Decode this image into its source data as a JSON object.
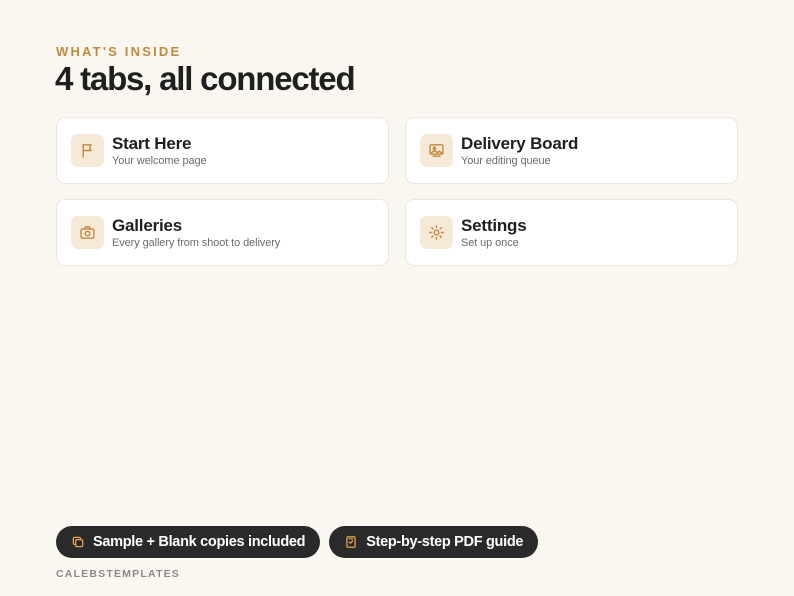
{
  "header": {
    "eyebrow": "WHAT'S INSIDE",
    "title": "4 tabs, all connected"
  },
  "cards": [
    {
      "icon": "flag-icon",
      "title": "Start Here",
      "subtitle": "Your welcome page"
    },
    {
      "icon": "image-board-icon",
      "title": "Delivery Board",
      "subtitle": "Your editing queue"
    },
    {
      "icon": "camera-icon",
      "title": "Galleries",
      "subtitle": "Every gallery from shoot to delivery"
    },
    {
      "icon": "sun-settings-icon",
      "title": "Settings",
      "subtitle": "Set up once"
    }
  ],
  "pills": [
    {
      "icon": "copy-icon",
      "label": "Sample + Blank copies included"
    },
    {
      "icon": "checklist-icon",
      "label": "Step-by-step PDF guide"
    }
  ],
  "footer": {
    "brand": "CALEBSTEMPLATES"
  },
  "colors": {
    "background": "#faf7f1",
    "accent": "#c08a3e",
    "icon_tile": "#f7e9d8",
    "pill_bg": "#2a2a2a",
    "pill_icon": "#e3a24b"
  }
}
